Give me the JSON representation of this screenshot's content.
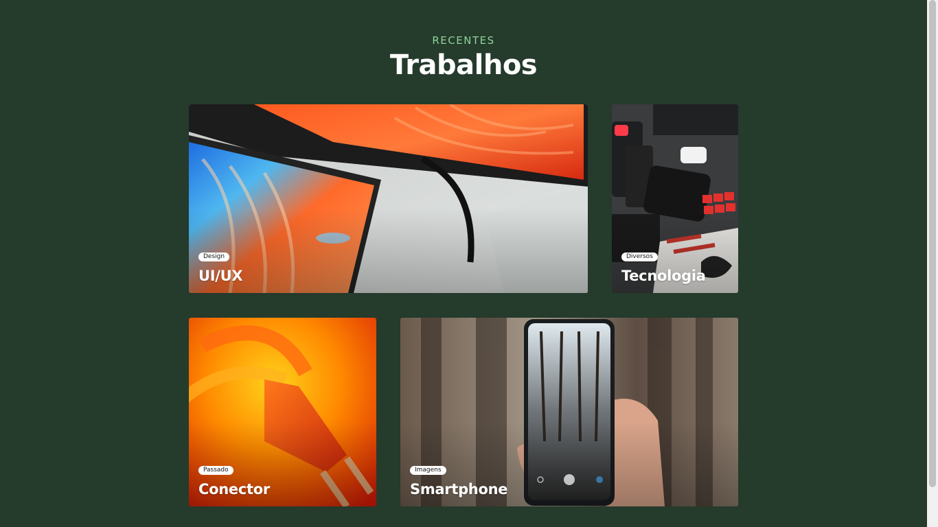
{
  "section": {
    "eyebrow": "RECENTES",
    "title": "Trabalhos"
  },
  "cards": [
    {
      "tag": "Design",
      "title": "UI/UX",
      "image": "monitor-laptop-image"
    },
    {
      "tag": "Diversos",
      "title": "Tecnologia",
      "image": "tech-flatlay-image"
    },
    {
      "tag": "Passado",
      "title": "Conector",
      "image": "power-plug-image"
    },
    {
      "tag": "Imagens",
      "title": "Smartphone",
      "image": "smartphone-forest-image"
    }
  ],
  "colors": {
    "background": "#253b2c",
    "eyebrow": "#8fd39a",
    "title": "#ffffff",
    "tag_bg": "#ffffff"
  }
}
